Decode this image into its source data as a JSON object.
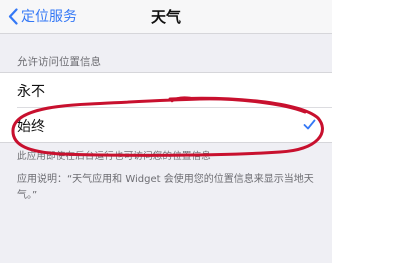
{
  "navbar": {
    "back_label": "定位服务",
    "title": "天气"
  },
  "section": {
    "header": "允许访问位置信息"
  },
  "options": [
    {
      "label": "永不",
      "selected": false
    },
    {
      "label": "始终",
      "selected": true
    }
  ],
  "footer": {
    "note": "此应用即使在后台运行也可访问您的位置信息",
    "description": "应用说明：“天气应用和 Widget 会使用您的位置信息来显示当地天气。”"
  },
  "colors": {
    "accent": "#3478f6",
    "annotation": "#c8102e"
  }
}
